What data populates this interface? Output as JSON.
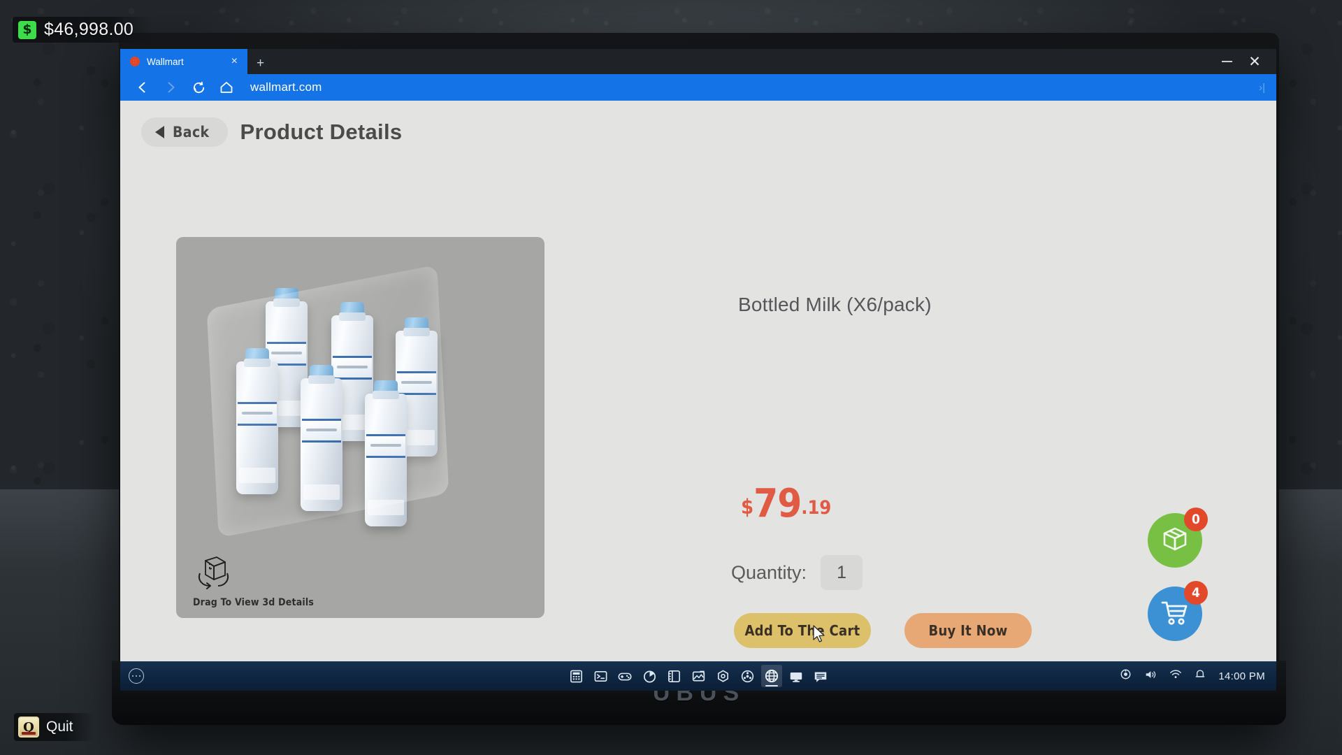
{
  "hud": {
    "money": "$46,998.00",
    "money_icon": "dollar-badge-icon",
    "quit_label": "Quit",
    "quit_key": "Q"
  },
  "laptop": {
    "brand": "UBUS"
  },
  "browser": {
    "tab": {
      "title": "Wallmart",
      "favicon": "wallmart-favicon",
      "close_label": "×",
      "new_tab_label": "+"
    },
    "window_controls": {
      "minimize": "minimize-icon",
      "close": "✕"
    },
    "nav": {
      "back": "back-arrow-icon",
      "forward": "forward-arrow-icon",
      "reload": "reload-icon",
      "home": "home-icon",
      "url": "wallmart.com",
      "overflow": "›|"
    }
  },
  "page": {
    "back_label": "Back",
    "title": "Product Details",
    "product": {
      "name": "Bottled Milk (X6/pack)",
      "price_currency": "$",
      "price_integer": "79",
      "price_decimal": ".19",
      "price_color": "#e05a44",
      "image_hint": "Drag To View 3d Details",
      "image_hint_icon": "rotate-3d-cube-icon"
    },
    "quantity": {
      "label": "Quantity:",
      "value": "1"
    },
    "actions": {
      "add_to_cart": "Add To The Cart",
      "add_to_cart_color": "#dcc06a",
      "buy_now": "Buy It Now",
      "buy_now_color": "#e7a875"
    },
    "widgets": {
      "orders": {
        "icon": "package-box-icon",
        "badge": "0",
        "color": "#77c043"
      },
      "cart": {
        "icon": "shopping-cart-icon",
        "badge": "4",
        "color": "#3c90d4"
      }
    }
  },
  "taskbar": {
    "start_icon": "start-menu-icon",
    "apps": [
      {
        "icon": "calculator-icon",
        "active": false
      },
      {
        "icon": "terminal-icon",
        "active": false
      },
      {
        "icon": "game-controller-icon",
        "active": false
      },
      {
        "icon": "power-meter-icon",
        "active": false
      },
      {
        "icon": "notebook-icon",
        "active": false
      },
      {
        "icon": "photo-editor-icon",
        "active": false
      },
      {
        "icon": "settings-hex-icon",
        "active": false
      },
      {
        "icon": "film-reel-icon",
        "active": false
      },
      {
        "icon": "browser-globe-icon",
        "active": true
      },
      {
        "icon": "monitor-icon",
        "active": false
      },
      {
        "icon": "chat-icon",
        "active": false
      }
    ],
    "tray": [
      {
        "icon": "eye-tracker-icon"
      },
      {
        "icon": "volume-icon"
      },
      {
        "icon": "wifi-icon"
      },
      {
        "icon": "bell-icon"
      }
    ],
    "clock": "14:00 PM"
  }
}
